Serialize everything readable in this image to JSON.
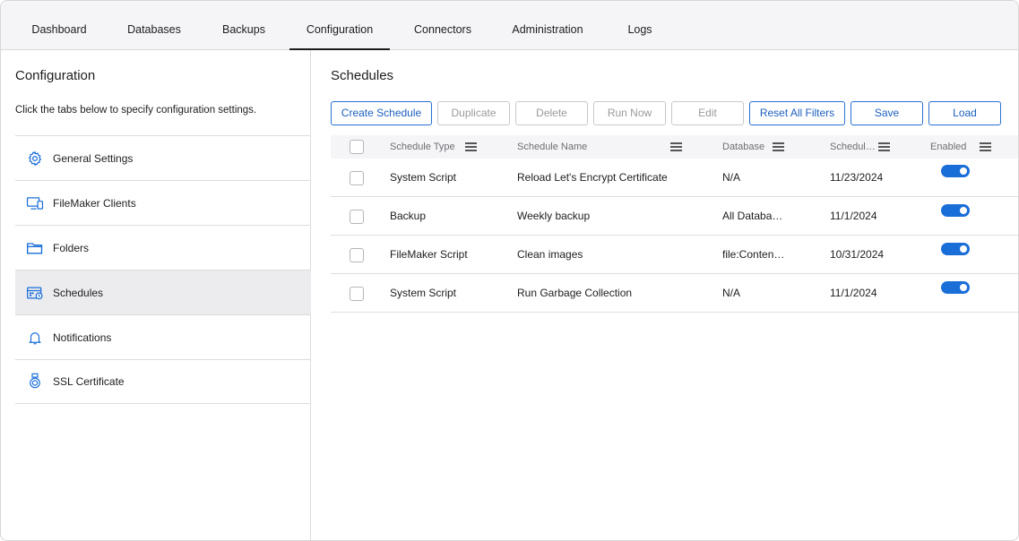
{
  "nav": {
    "tabs": [
      {
        "label": "Dashboard"
      },
      {
        "label": "Databases"
      },
      {
        "label": "Backups"
      },
      {
        "label": "Configuration",
        "active": true
      },
      {
        "label": "Connectors"
      },
      {
        "label": "Administration"
      },
      {
        "label": "Logs"
      }
    ]
  },
  "sidebar": {
    "title": "Configuration",
    "description": "Click the tabs below to specify configuration settings.",
    "items": [
      {
        "label": "General Settings",
        "icon": "gear-icon"
      },
      {
        "label": "FileMaker Clients",
        "icon": "devices-icon"
      },
      {
        "label": "Folders",
        "icon": "folder-icon"
      },
      {
        "label": "Schedules",
        "icon": "schedule-icon",
        "active": true
      },
      {
        "label": "Notifications",
        "icon": "bell-icon"
      },
      {
        "label": "SSL Certificate",
        "icon": "certificate-icon"
      }
    ]
  },
  "main": {
    "title": "Schedules",
    "toolbar": {
      "create": "Create Schedule",
      "duplicate": "Duplicate",
      "delete": "Delete",
      "run_now": "Run Now",
      "edit": "Edit",
      "reset_filters": "Reset All Filters",
      "save": "Save",
      "load": "Load"
    },
    "table": {
      "columns": [
        "Schedule Type",
        "Schedule Name",
        "Database",
        "Schedul…",
        "Enabled"
      ],
      "rows": [
        {
          "type": "System Script",
          "name": "Reload Let's Encrypt Certificate",
          "database": "N/A",
          "date": "11/23/2024",
          "enabled": true
        },
        {
          "type": "Backup",
          "name": "Weekly backup",
          "database": "All Databa…",
          "date": "11/1/2024",
          "enabled": true
        },
        {
          "type": "FileMaker Script",
          "name": "Clean images",
          "database": "file:Conten…",
          "date": "10/31/2024",
          "enabled": true
        },
        {
          "type": "System Script",
          "name": "Run Garbage Collection",
          "database": "N/A",
          "date": "11/1/2024",
          "enabled": true
        }
      ]
    }
  },
  "colors": {
    "accent": "#1a6ed8",
    "nav_bg": "#f5f5f7",
    "border": "#dcdcdc"
  }
}
